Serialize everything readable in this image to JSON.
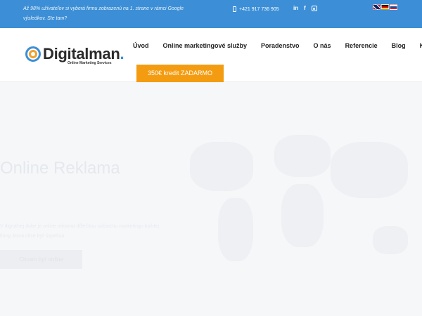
{
  "topbar": {
    "promo": "Až 98% užívateľov si vyberá firmu zobrazenú na 1. strane v rámci Google výsledkov. Ste tam?",
    "phone": "+421 917 736 905",
    "social": [
      {
        "icon": "linkedin-icon",
        "glyph": "in"
      },
      {
        "icon": "facebook-icon",
        "glyph": "f"
      },
      {
        "icon": "instagram-icon",
        "glyph": ""
      }
    ],
    "languages": [
      "en",
      "de",
      "sk"
    ]
  },
  "header": {
    "logo_text": "Digitalman",
    "logo_dot": ".",
    "logo_sub": "Online Marketing Services",
    "nav": [
      "Úvod",
      "Online marketingové služby",
      "Poradenstvo",
      "O nás",
      "Referencie",
      "Blog",
      "Ko"
    ],
    "cta": "350€ kredit ZADARMO"
  },
  "hero": {
    "title": "Online Reklama",
    "text": "V digitálnej dobe je online reklama dôležitou súčasťou marketingu každej firmy, ktorá chce byť úspešná.",
    "button": "Chcem byť online"
  },
  "colors": {
    "topbar": "#3c8fd6",
    "accent": "#f39c12"
  }
}
